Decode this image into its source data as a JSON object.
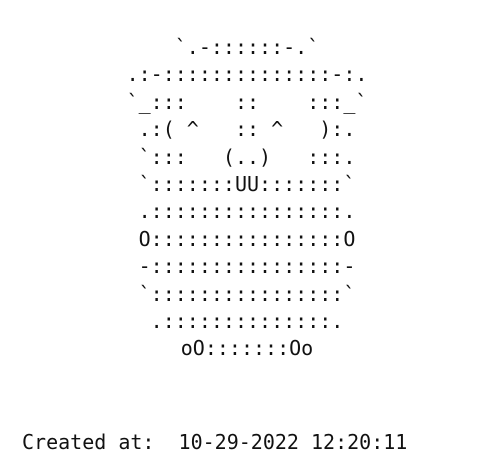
{
  "art": {
    "lines": [
      "`.-::::::-.`",
      ".:-::::::::::::::-:.",
      "`_:::    ::    :::_`",
      ".:( ^   :: ^   ):.",
      "`:::   (..)   :::.",
      "`:::::::UU:::::::`",
      ".::::::::::::::::.",
      "O::::::::::::::::O",
      "-::::::::::::::::-",
      "`::::::::::::::::`",
      ".::::::::::::::.",
      "oO:::::::Oo"
    ]
  },
  "footer": {
    "label": "Created at:",
    "value": "10-29-2022 12:20:11"
  }
}
